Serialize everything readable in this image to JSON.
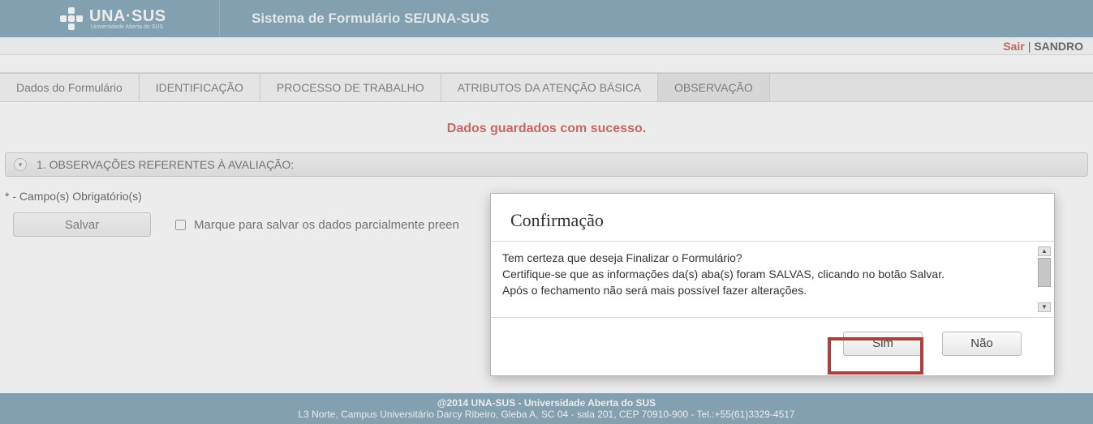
{
  "header": {
    "logo_text": "UNA·SUS",
    "logo_subtext": "Universidade Aberta do SUS",
    "system_title": "Sistema de Formulário SE/UNA-SUS"
  },
  "userbar": {
    "signout_label": "Sair",
    "separator": "|",
    "username": "SANDRO"
  },
  "tabs": [
    {
      "id": "dados",
      "label": "Dados do Formulário",
      "active": false
    },
    {
      "id": "ident",
      "label": "IDENTIFICAÇÃO",
      "active": false
    },
    {
      "id": "proc",
      "label": "PROCESSO DE TRABALHO",
      "active": false
    },
    {
      "id": "atrib",
      "label": "ATRIBUTOS DA ATENÇÃO BÁSICA",
      "active": false
    },
    {
      "id": "obs",
      "label": "OBSERVAÇÃO",
      "active": true
    }
  ],
  "success_message": "Dados guardados com sucesso.",
  "accordion": {
    "title": "1. OBSERVAÇÕES REFERENTES À AVALIAÇÃO:"
  },
  "form": {
    "required_note": "* - Campo(s) Obrigatório(s)",
    "save_label": "Salvar",
    "partial_save_label": "Marque para salvar os dados parcialmente preen"
  },
  "modal": {
    "title": "Confirmação",
    "line1": "Tem certeza que deseja Finalizar o Formulário?",
    "line2": "Certifique-se que as informações da(s) aba(s) foram SALVAS, clicando no botão Salvar.",
    "line3": "Após o fechamento não será mais possível fazer alterações.",
    "yes_label": "Sim",
    "no_label": "Não"
  },
  "footer": {
    "line1": "@2014 UNA-SUS - Universidade Aberta do SUS",
    "line2": "L3 Norte, Campus Universitário Darcy Ribeiro, Gleba A, SC 04 - sala 201, CEP 70910-900 - Tel.:+55(61)3329-4517"
  }
}
